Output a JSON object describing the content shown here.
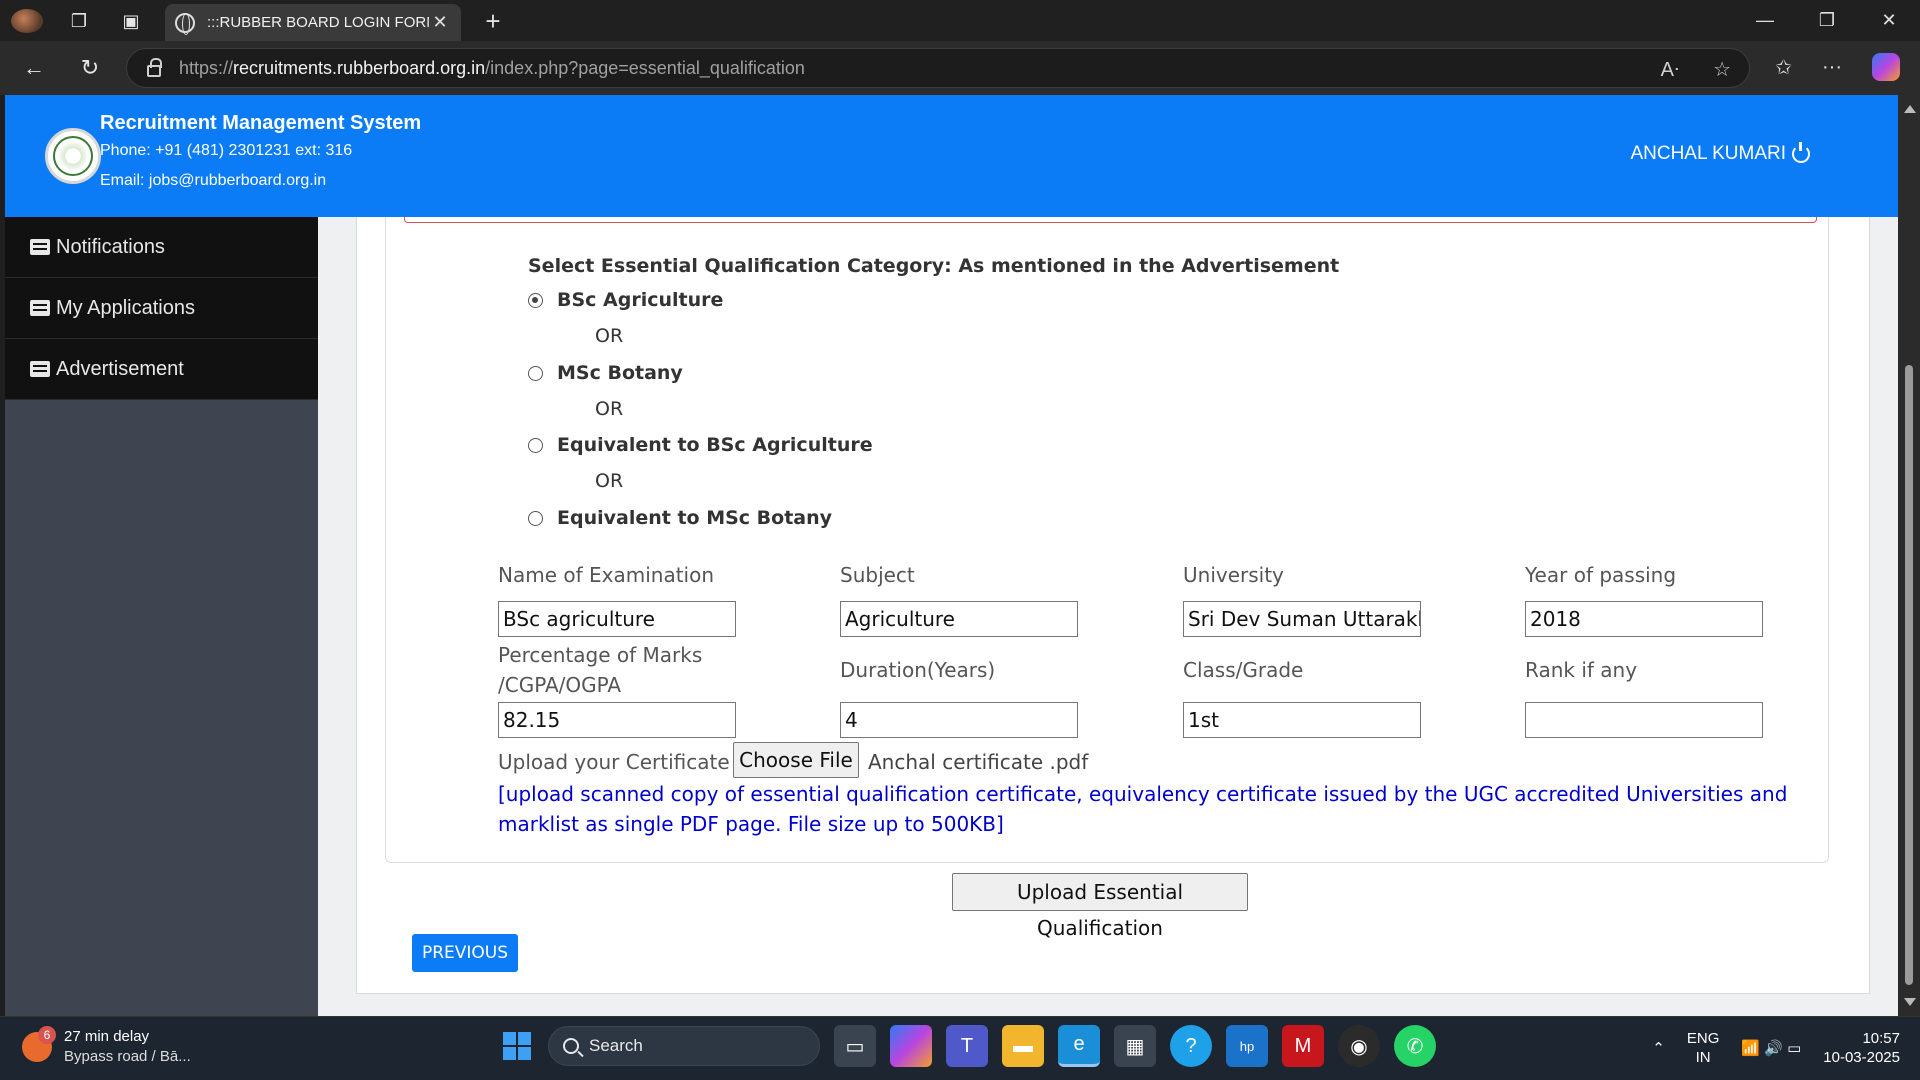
{
  "browser": {
    "tab_title": ":::RUBBER BOARD LOGIN FORM::.",
    "url_prefix": "https://",
    "url_host": "recruitments.rubberboard.org.in",
    "url_path": "/index.php?page=essential_qualification"
  },
  "header": {
    "title": "Recruitment Management System",
    "phone": "Phone: +91 (481) 2301231 ext: 316",
    "email": "Email: jobs@rubberboard.org.in",
    "user": "ANCHAL KUMARI"
  },
  "sidebar": {
    "items": [
      {
        "label": "Notifications"
      },
      {
        "label": "My Applications"
      },
      {
        "label": "Advertisement"
      }
    ]
  },
  "form": {
    "heading": "Select Essential Qualification Category: As mentioned in the Advertisement",
    "options": [
      {
        "label": "BSc Agriculture",
        "checked": true
      },
      {
        "label": "MSc Botany",
        "checked": false
      },
      {
        "label": "Equivalent to BSc Agriculture",
        "checked": false
      },
      {
        "label": "Equivalent to MSc Botany",
        "checked": false
      }
    ],
    "or_label": "OR",
    "fields": {
      "exam_label": "Name of Examination",
      "exam_value": "BSc agriculture",
      "subject_label": "Subject",
      "subject_value": "Agriculture",
      "university_label": "University",
      "university_value": "Sri Dev Suman Uttarakhand",
      "year_label": "Year of passing",
      "year_value": "2018",
      "marks_label_1": "Percentage of Marks",
      "marks_label_2": "/CGPA/OGPA",
      "marks_value": "82.15",
      "duration_label": "Duration(Years)",
      "duration_value": "4",
      "class_label": "Class/Grade",
      "class_value": "1st",
      "rank_label": "Rank if any",
      "rank_value": ""
    },
    "upload_label": "Upload your Certificate :",
    "choose_file": "Choose File",
    "file_name": "Anchal certificate .pdf",
    "upload_note": "[upload scanned copy of essential qualification certificate, equivalency certificate issued by the UGC accredited Universities and marklist as single PDF page. File size up to 500KB]",
    "upload_button": "Upload Essential Qualification",
    "previous_button": "PREVIOUS"
  },
  "taskbar": {
    "weather_badge": "6",
    "weather_title": "27 min delay",
    "weather_sub": "Bypass road / Bā...",
    "search": "Search",
    "lang_1": "ENG",
    "lang_2": "IN",
    "time": "10:57",
    "date": "10-03-2025"
  },
  "colors": {
    "header_blue": "#0b7cf5",
    "sidebar_dark": "#111111",
    "note_blue": "#0000cc"
  }
}
